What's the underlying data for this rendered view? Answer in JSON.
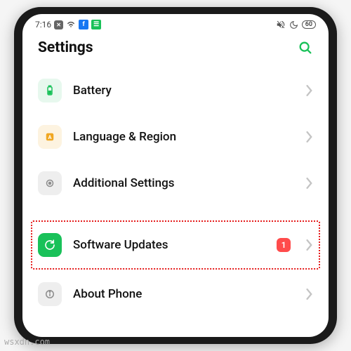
{
  "status": {
    "time": "7:16",
    "battery": "60"
  },
  "header": {
    "title": "Settings"
  },
  "rows": {
    "battery": {
      "label": "Battery",
      "icon_bg": "#e7f8ee",
      "icon_fg": "#19c159"
    },
    "language": {
      "label": "Language & Region",
      "icon_bg": "#fdf3e0",
      "icon_fg": "#f0a722"
    },
    "additional": {
      "label": "Additional Settings",
      "icon_bg": "#eeeeee",
      "icon_fg": "#8d8d8d"
    },
    "updates": {
      "label": "Software Updates",
      "icon_bg": "#19c159",
      "icon_fg": "#ffffff",
      "badge": "1"
    },
    "about": {
      "label": "About Phone",
      "icon_bg": "#eeeeee",
      "icon_fg": "#8d8d8d"
    }
  },
  "watermark": "wsxdn.com"
}
